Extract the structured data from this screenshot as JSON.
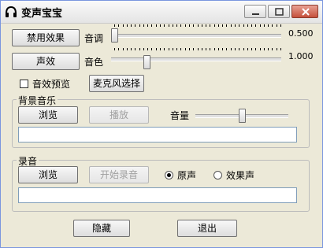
{
  "window": {
    "title": "变声宝宝"
  },
  "buttons": {
    "disable_effect": "禁用效果",
    "sound_effect": "声效",
    "mic_select": "麦克风选择",
    "hide": "隐藏",
    "exit": "退出"
  },
  "pitch": {
    "label": "音调",
    "value_text": "0.500",
    "level": 0.0
  },
  "timbre": {
    "label": "音色",
    "value_text": "1.000",
    "level": 0.2
  },
  "preview": {
    "label": "音效预览",
    "checked": false
  },
  "bg_music": {
    "title": "背景音乐",
    "browse": "浏览",
    "play": "播放",
    "volume_label": "音量",
    "volume_level": 0.5,
    "file_path": ""
  },
  "record": {
    "title": "录音",
    "browse": "浏览",
    "start": "开始录音",
    "opt_original": "原声",
    "opt_effect": "效果声",
    "selected": "原声",
    "file_path": ""
  }
}
